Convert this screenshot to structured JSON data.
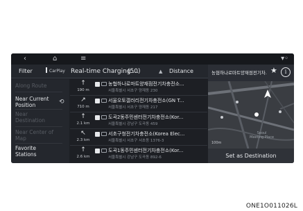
{
  "statusbar": {
    "back": "‹",
    "home": "⌂",
    "menu": "≡",
    "signal": "▾◦"
  },
  "header": {
    "filter": "Filter",
    "carplay": "CarPlay",
    "title": "Real-time Charging ...",
    "count": "(50)",
    "sort_icon": "▲",
    "distance": "Distance"
  },
  "leftnav": [
    {
      "label": "Along Route",
      "active": false
    },
    {
      "label": "Near Current Position",
      "active": true
    },
    {
      "label": "Near Destination",
      "active": false
    },
    {
      "label": "Near Center of Map",
      "active": false
    },
    {
      "label": "Favorite Stations",
      "active": true
    }
  ],
  "list": [
    {
      "dir": "↑",
      "dist": "190 m",
      "name": "농협하나로마트양재점전기차충전소...",
      "addr": "서울특별시 서초구 양재동 230"
    },
    {
      "dir": "↗",
      "dist": "710 m",
      "name": "서울오토갤러리전기차충전소(GN T...",
      "addr": "서울특별시 서초구 양재동 217"
    },
    {
      "dir": "↑",
      "dist": "2.1 km",
      "name": "도곡2동주민센터전기차충전소(Kor...",
      "addr": "서울특별시 강남구 도곡동 459"
    },
    {
      "dir": "↖",
      "dist": "2.3 km",
      "name": "서초구청전기차충전소(Korea Elec...",
      "addr": "서울특별시 서초구 서초동 1376-3"
    },
    {
      "dir": "↑",
      "dist": "2.6 km",
      "name": "도곡1동주민센터전기차충전소(Kor...",
      "addr": "서울특별시 강남구 도곡동 892-6"
    }
  ],
  "detail": {
    "name": "농협하나로마트양재점전기차...",
    "star": "★",
    "info": "i",
    "scale": "100m",
    "poi_label": "Seoul\nMeeting Place",
    "set_destination": "Set as Destination"
  },
  "caption": "ONE1O011026L",
  "colors": {
    "screen_bg": "#1d1f24",
    "panel_bg": "#24272d",
    "map_bg": "#3a3d42",
    "text": "#e6e8eb",
    "dim_text": "#585c63"
  }
}
